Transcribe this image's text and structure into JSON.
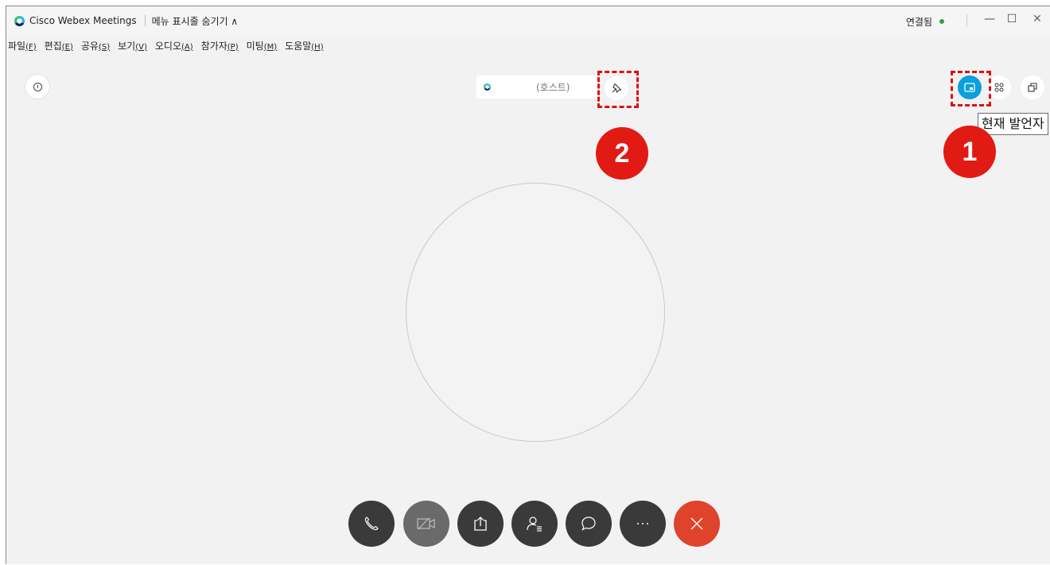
{
  "titlebar": {
    "app_title": "Cisco Webex Meetings",
    "menu_toggle": "메뉴 표시줄 숨기기 ∧",
    "connection_status": "연결됨",
    "minimize": "—",
    "maximize": "☐",
    "close": "✕"
  },
  "menubar": {
    "items": [
      {
        "label": "파일",
        "accel": "(F)"
      },
      {
        "label": "편집",
        "accel": "(E)"
      },
      {
        "label": "공유",
        "accel": "(S)"
      },
      {
        "label": "보기",
        "accel": "(V)"
      },
      {
        "label": "오디오",
        "accel": "(A)"
      },
      {
        "label": "참가자",
        "accel": "(P)"
      },
      {
        "label": "미팅",
        "accel": "(M)"
      },
      {
        "label": "도움말",
        "accel": "(H)"
      }
    ]
  },
  "speaker": {
    "role": "(호스트)"
  },
  "layout": {
    "tooltip": "현재 발언자"
  },
  "annotations": {
    "badge_1": "1",
    "badge_2": "2"
  },
  "colors": {
    "accent_blue": "#0b9fdc",
    "leave_red": "#e0432b",
    "annotation_red": "#e21a14",
    "connected_green": "#2ea043"
  },
  "icons": {
    "audio": "phone-icon",
    "video": "video-off-icon",
    "share": "share-icon",
    "participants": "participants-icon",
    "chat": "chat-icon",
    "more": "more-icon",
    "leave": "close-icon"
  }
}
